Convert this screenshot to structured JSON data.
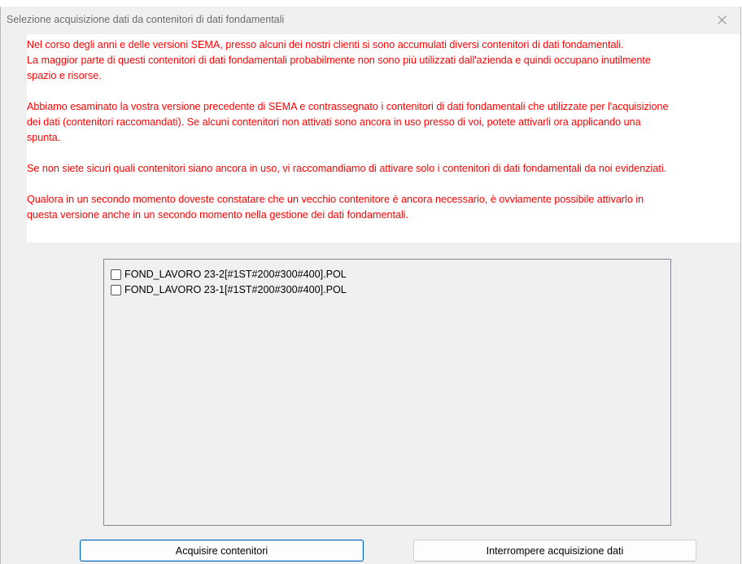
{
  "window": {
    "title": "Selezione acquisizione dati da contenitori di dati fondamentali"
  },
  "info": {
    "paragraphs": [
      "Nel corso degli anni e delle versioni SEMA, presso alcuni dei nostri clienti si sono accumulati diversi contenitori di dati fondamentali.\nLa maggior parte di questi contenitori di dati fondamentali probabilmente non sono più utilizzati dall'azienda e quindi occupano inutilmente\nspazio e risorse.",
      "Abbiamo esaminato la vostra versione precedente di SEMA e contrassegnato i contenitori di dati fondamentali che utilizzate per l'acquisizione\ndei dati (contenitori raccomandati). Se alcuni contenitori non attivati sono ancora in uso presso di voi, potete attivarli ora applicando una\nspunta.",
      "Se non siete sicuri quali contenitori siano ancora in uso, vi raccomandiamo di attivare solo i contenitori di dati fondamentali da noi evidenziati.",
      "Qualora in un secondo momento doveste constatare che un vecchio contenitore è ancora necessario, è ovviamente possibile attivarlo in\nquesta versione anche in un secondo momento nella gestione dei dati fondamentali."
    ],
    "text_color": "#ff0000"
  },
  "containers": {
    "items": [
      {
        "label": "FOND_LAVORO 23-2[#1ST#200#300#400].POL",
        "checked": false
      },
      {
        "label": "FOND_LAVORO 23-1[#1ST#200#300#400].POL",
        "checked": false
      }
    ]
  },
  "buttons": {
    "acquire_label": "Acquisire contenitori",
    "cancel_label": "Interrompere acquisizione dati"
  },
  "icons": {
    "close": "close-icon"
  },
  "colors": {
    "accent": "#0067c0",
    "window_bg": "#f0f0f0"
  }
}
